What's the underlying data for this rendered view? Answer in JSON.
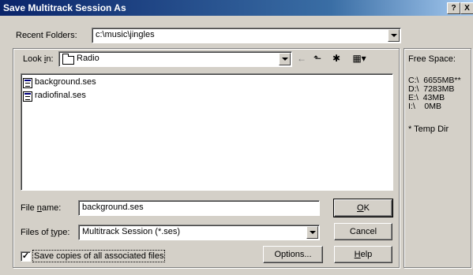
{
  "window": {
    "title": "Save Multitrack Session As",
    "help_label": "?",
    "close_label": "X"
  },
  "recent_folders": {
    "label": "Recent Folders:",
    "value": "c:\\music\\jingles"
  },
  "look_in": {
    "label_pre": "Look ",
    "label_accel": "i",
    "label_post": "n:",
    "value": "Radio"
  },
  "toolbar": {
    "back_icon": "←",
    "up_icon": "⬑",
    "new_folder_icon": "✱",
    "view_icon": "▦▾"
  },
  "files": [
    {
      "name": "background.ses"
    },
    {
      "name": "radiofinal.ses"
    }
  ],
  "file_name": {
    "label_pre": "File ",
    "label_accel": "n",
    "label_post": "ame:",
    "value": "background.ses"
  },
  "file_type": {
    "label_pre": "Files of ",
    "label_accel": "t",
    "label_post": "ype:",
    "value": "Multitrack Session (*.ses)"
  },
  "buttons": {
    "ok": {
      "accel": "O",
      "rest": "K"
    },
    "cancel": "Cancel",
    "options": "Options...",
    "help": {
      "accel": "H",
      "rest": "elp"
    }
  },
  "save_copies": {
    "checked": true,
    "check_mark": "✓",
    "label": "Save copies of all associated files"
  },
  "free_space": {
    "title": "Free Space:",
    "drives": [
      "C:\\  6655MB**",
      "D:\\  7283MB",
      "E:\\  43MB",
      "I:\\    0MB"
    ],
    "note": "* Temp Dir"
  }
}
